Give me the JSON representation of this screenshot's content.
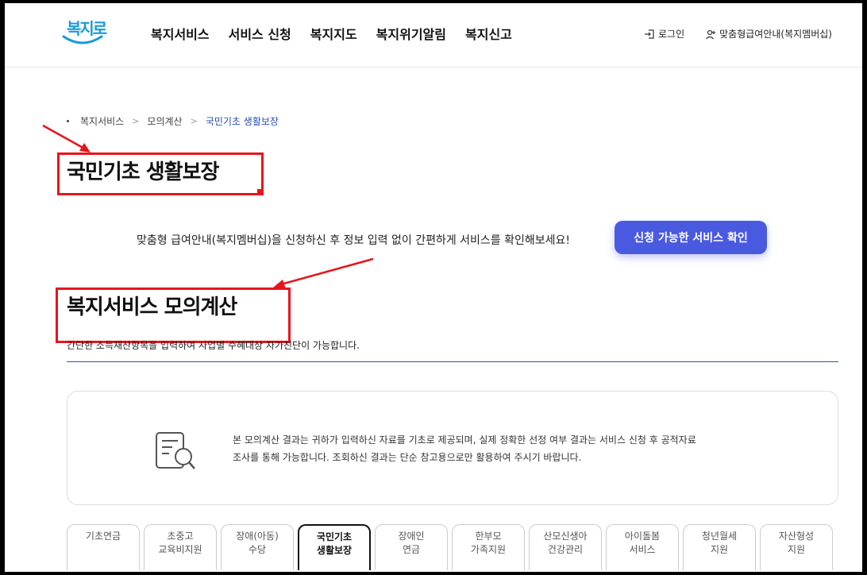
{
  "header": {
    "logo_text": "복지로",
    "nav": [
      "복지서비스",
      "서비스 신청",
      "복지지도",
      "복지위기알림",
      "복지신고"
    ],
    "login_label": "로그인",
    "member_label": "맞춤형급여안내(복지멤버십)"
  },
  "breadcrumb": [
    "복지서비스",
    "모의계산",
    "국민기초 생활보장"
  ],
  "page_title": "국민기초 생활보장",
  "notice": {
    "text": "맞춤형 급여안내(복지멤버십)을 신청하신 후 정보 입력 없이 간편하게 서비스를 확인해보세요!",
    "button_label": "신청 가능한 서비스 확인"
  },
  "section": {
    "title": "복지서비스 모의계산",
    "description": "간단한 소득재산항목을 입력하여 사업별 수혜대상 자가진단이 가능합니다."
  },
  "info": {
    "line1": "본 모의계산 결과는 귀하가 입력하신 자료를 기초로 제공되며, 실제 정확한 선정 여부 결과는 서비스 신청 후 공적자료",
    "line2": "조사를 통해 가능합니다. 조회하신 결과는 단순 참고용으로만 활용하여 주시기 바랍니다."
  },
  "tabs": [
    {
      "line1": "기초연금",
      "line2": ""
    },
    {
      "line1": "초중고",
      "line2": "교육비지원"
    },
    {
      "line1": "장애(아동)",
      "line2": "수당"
    },
    {
      "line1": "국민기초",
      "line2": "생활보장",
      "active": true
    },
    {
      "line1": "장애인",
      "line2": "연금"
    },
    {
      "line1": "한부모",
      "line2": "가족지원"
    },
    {
      "line1": "산모신생아",
      "line2": "건강관리"
    },
    {
      "line1": "아이돌봄",
      "line2": "서비스"
    },
    {
      "line1": "청년월세",
      "line2": "지원"
    },
    {
      "line1": "자산형성",
      "line2": "지원"
    }
  ],
  "colors": {
    "accent": "#4a5ae0",
    "highlight": "#e8141c",
    "breadcrumb_current": "#2b4fb5"
  }
}
